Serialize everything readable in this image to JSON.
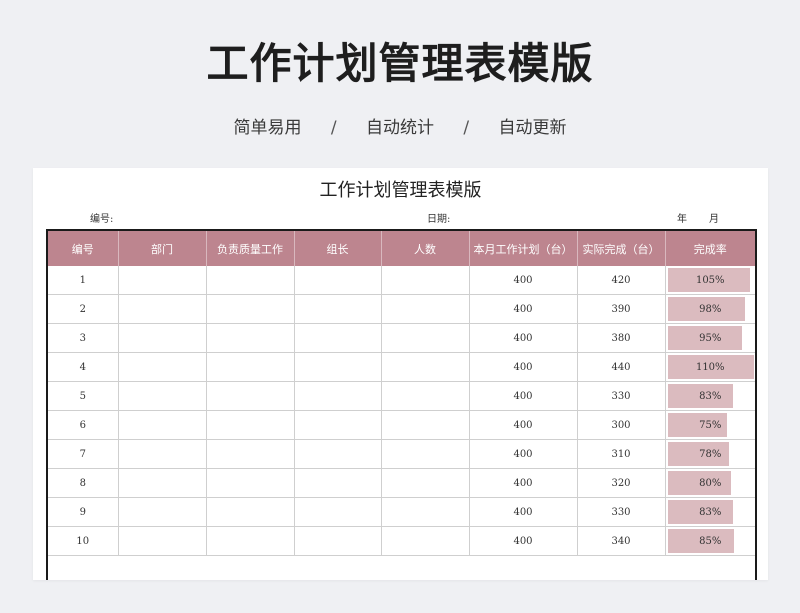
{
  "header": {
    "title": "工作计划管理表模版",
    "tags": [
      "简单易用",
      "自动统计",
      "自动更新"
    ],
    "separator": "/"
  },
  "sheet": {
    "title": "工作计划管理表模版",
    "id_label": "编号:",
    "date_label": "日期:",
    "year_label": "年",
    "month_label": "月",
    "columns": [
      "编号",
      "部门",
      "负责质量工作",
      "组长",
      "人数",
      "本月工作计划（台）",
      "实际完成（台）",
      "完成率"
    ],
    "rows": [
      {
        "no": "1",
        "dept": "",
        "quality": "",
        "leader": "",
        "people": "",
        "plan": "400",
        "actual": "420",
        "rate": "105%",
        "rate_value": 1.05
      },
      {
        "no": "2",
        "dept": "",
        "quality": "",
        "leader": "",
        "people": "",
        "plan": "400",
        "actual": "390",
        "rate": "98%",
        "rate_value": 0.98
      },
      {
        "no": "3",
        "dept": "",
        "quality": "",
        "leader": "",
        "people": "",
        "plan": "400",
        "actual": "380",
        "rate": "95%",
        "rate_value": 0.95
      },
      {
        "no": "4",
        "dept": "",
        "quality": "",
        "leader": "",
        "people": "",
        "plan": "400",
        "actual": "440",
        "rate": "110%",
        "rate_value": 1.1
      },
      {
        "no": "5",
        "dept": "",
        "quality": "",
        "leader": "",
        "people": "",
        "plan": "400",
        "actual": "330",
        "rate": "83%",
        "rate_value": 0.83
      },
      {
        "no": "6",
        "dept": "",
        "quality": "",
        "leader": "",
        "people": "",
        "plan": "400",
        "actual": "300",
        "rate": "75%",
        "rate_value": 0.75
      },
      {
        "no": "7",
        "dept": "",
        "quality": "",
        "leader": "",
        "people": "",
        "plan": "400",
        "actual": "310",
        "rate": "78%",
        "rate_value": 0.78
      },
      {
        "no": "8",
        "dept": "",
        "quality": "",
        "leader": "",
        "people": "",
        "plan": "400",
        "actual": "320",
        "rate": "80%",
        "rate_value": 0.8
      },
      {
        "no": "9",
        "dept": "",
        "quality": "",
        "leader": "",
        "people": "",
        "plan": "400",
        "actual": "330",
        "rate": "83%",
        "rate_value": 0.83
      },
      {
        "no": "10",
        "dept": "",
        "quality": "",
        "leader": "",
        "people": "",
        "plan": "400",
        "actual": "340",
        "rate": "85%",
        "rate_value": 0.85
      }
    ]
  },
  "colors": {
    "header_fill": "#bd858f",
    "bar_fill": "#dbbbbf",
    "page_bg": "#eff0f3"
  }
}
